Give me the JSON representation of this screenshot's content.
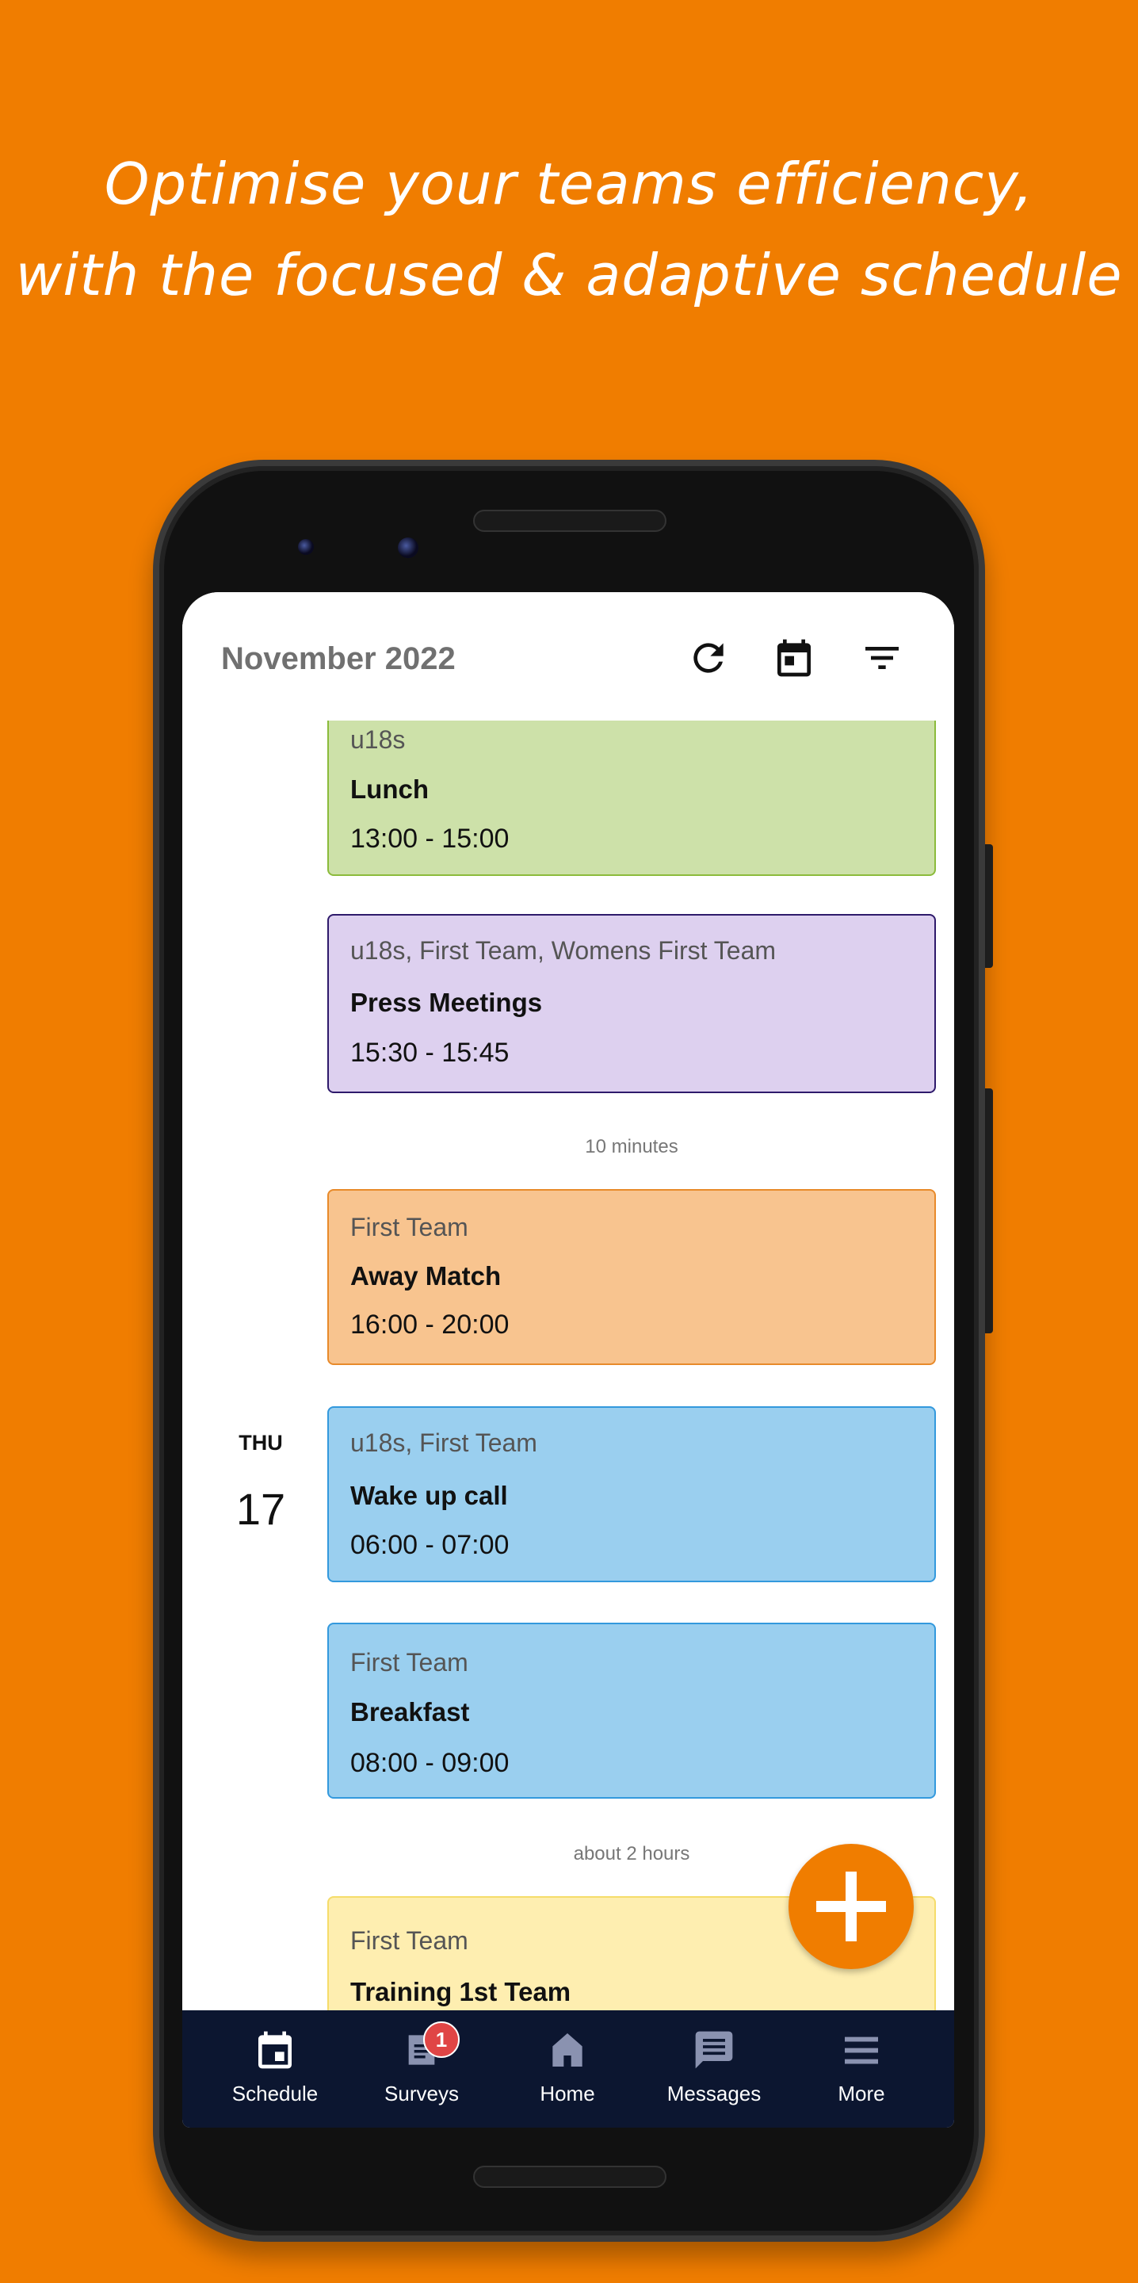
{
  "headline": {
    "line1": "Optimise your teams efficiency,",
    "line2": "with the focused & adaptive schedule"
  },
  "header": {
    "title": "November 2022",
    "icons": [
      "refresh-icon",
      "calendar-today-icon",
      "filter-icon"
    ]
  },
  "events": [
    {
      "teams": "u18s",
      "title": "Lunch",
      "time": "13:00 - 15:00",
      "bg": "#cde1a9",
      "border": "#8bbb3b"
    },
    {
      "teams": "u18s, First Team, Womens First Team",
      "title": "Press Meetings",
      "time": "15:30 - 15:45",
      "bg": "#ddd0ef",
      "border": "#2e1a6b"
    },
    {
      "teams": "First Team",
      "title": "Away Match",
      "time": "16:00 - 20:00",
      "bg": "#f8c48f",
      "border": "#e88a2a"
    },
    {
      "teams": "u18s, First Team",
      "title": "Wake up call",
      "time": "06:00 - 07:00",
      "bg": "#9acfef",
      "border": "#3399dd"
    },
    {
      "teams": "First Team",
      "title": "Breakfast",
      "time": "08:00 - 09:00",
      "bg": "#9acfef",
      "border": "#3399dd"
    },
    {
      "teams": "First Team",
      "title": "Training 1st Team",
      "bg": "#feeeb0",
      "border": "#f5dc6a"
    }
  ],
  "gaps": [
    "10 minutes",
    "about 2 hours"
  ],
  "day": {
    "weekday": "THU",
    "date": "17"
  },
  "nav": [
    {
      "label": "Schedule",
      "icon": "calendar-icon",
      "active": true
    },
    {
      "label": "Surveys",
      "icon": "survey-icon",
      "badge": "1"
    },
    {
      "label": "Home",
      "icon": "home-icon"
    },
    {
      "label": "Messages",
      "icon": "message-icon"
    },
    {
      "label": "More",
      "icon": "menu-icon"
    }
  ],
  "fab": {
    "icon": "plus-icon"
  },
  "colors": {
    "background": "#f07d00",
    "nav": "#0c1630",
    "accent": "#f07d00",
    "inactive_icon": "#8a92b0"
  }
}
